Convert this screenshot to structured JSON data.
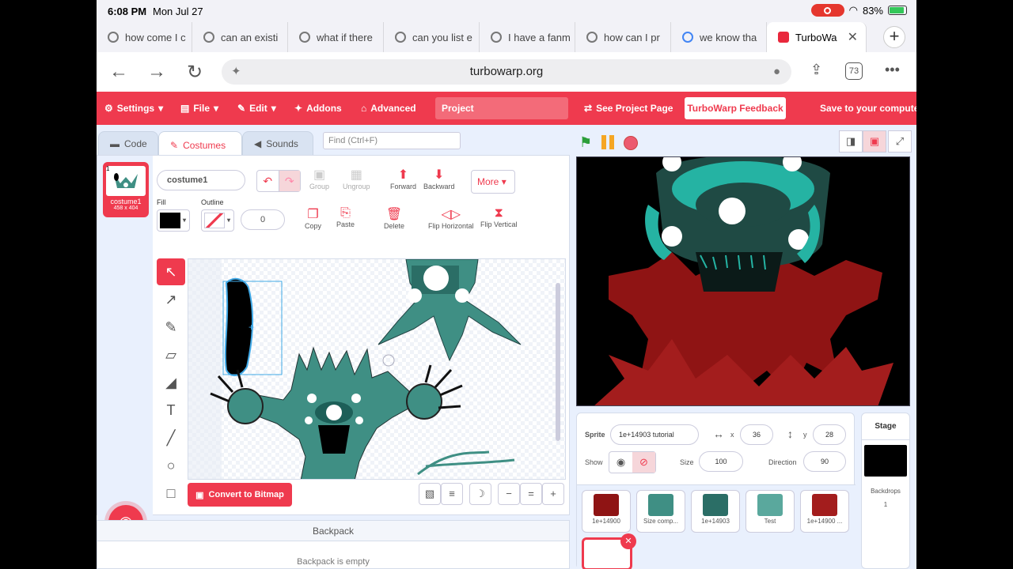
{
  "status": {
    "time": "6:08 PM",
    "date": "Mon Jul 27",
    "battery": "83%"
  },
  "tabs": [
    {
      "label": "how come I c"
    },
    {
      "label": "can an existi"
    },
    {
      "label": "what if there"
    },
    {
      "label": "can you list e"
    },
    {
      "label": "I have a fanm"
    },
    {
      "label": "how can I pr"
    },
    {
      "label": "we know tha"
    },
    {
      "label": "TurboWa"
    }
  ],
  "address": {
    "url": "turbowarp.org",
    "tab_count": "73"
  },
  "menu": {
    "settings": "Settings",
    "file": "File",
    "edit": "Edit",
    "addons": "Addons",
    "advanced": "Advanced",
    "project_title": "Project",
    "see_project": "See Project Page",
    "feedback": "TurboWarp Feedback",
    "save": "Save to your computer"
  },
  "editor_tabs": {
    "code": "Code",
    "costumes": "Costumes",
    "sounds": "Sounds"
  },
  "find": {
    "placeholder": "Find (Ctrl+F)"
  },
  "costume": {
    "number": "1",
    "name": "costume1",
    "size": "458 x 404",
    "outline_width": "0"
  },
  "paint_toolbar": {
    "group": "Group",
    "ungroup": "Ungroup",
    "forward": "Forward",
    "backward": "Backward",
    "more": "More",
    "fill": "Fill",
    "outline": "Outline",
    "copy": "Copy",
    "paste": "Paste",
    "delete": "Delete",
    "flip_h": "Flip Horizontal",
    "flip_v": "Flip Vertical",
    "convert": "Convert to Bitmap"
  },
  "backpack": {
    "title": "Backpack",
    "empty": "Backpack is empty"
  },
  "sprite_info": {
    "sprite_label": "Sprite",
    "sprite_name": "1e+14903 tutorial",
    "x_label": "x",
    "x": "36",
    "y_label": "y",
    "y": "28",
    "show_label": "Show",
    "size_label": "Size",
    "size": "100",
    "direction_label": "Direction",
    "direction": "90"
  },
  "sprites": [
    {
      "name": "1e+14900"
    },
    {
      "name": "Size comp..."
    },
    {
      "name": "1e+14903"
    },
    {
      "name": "Test"
    },
    {
      "name": "1e+14900 ..."
    }
  ],
  "stage_panel": {
    "title": "Stage",
    "backdrops_label": "Backdrops",
    "backdrops_count": "1"
  },
  "colors": {
    "accent": "#ef3a4e",
    "teal": "#3f8f84",
    "cyan": "#24c3b0",
    "red": "#a31d1d"
  }
}
